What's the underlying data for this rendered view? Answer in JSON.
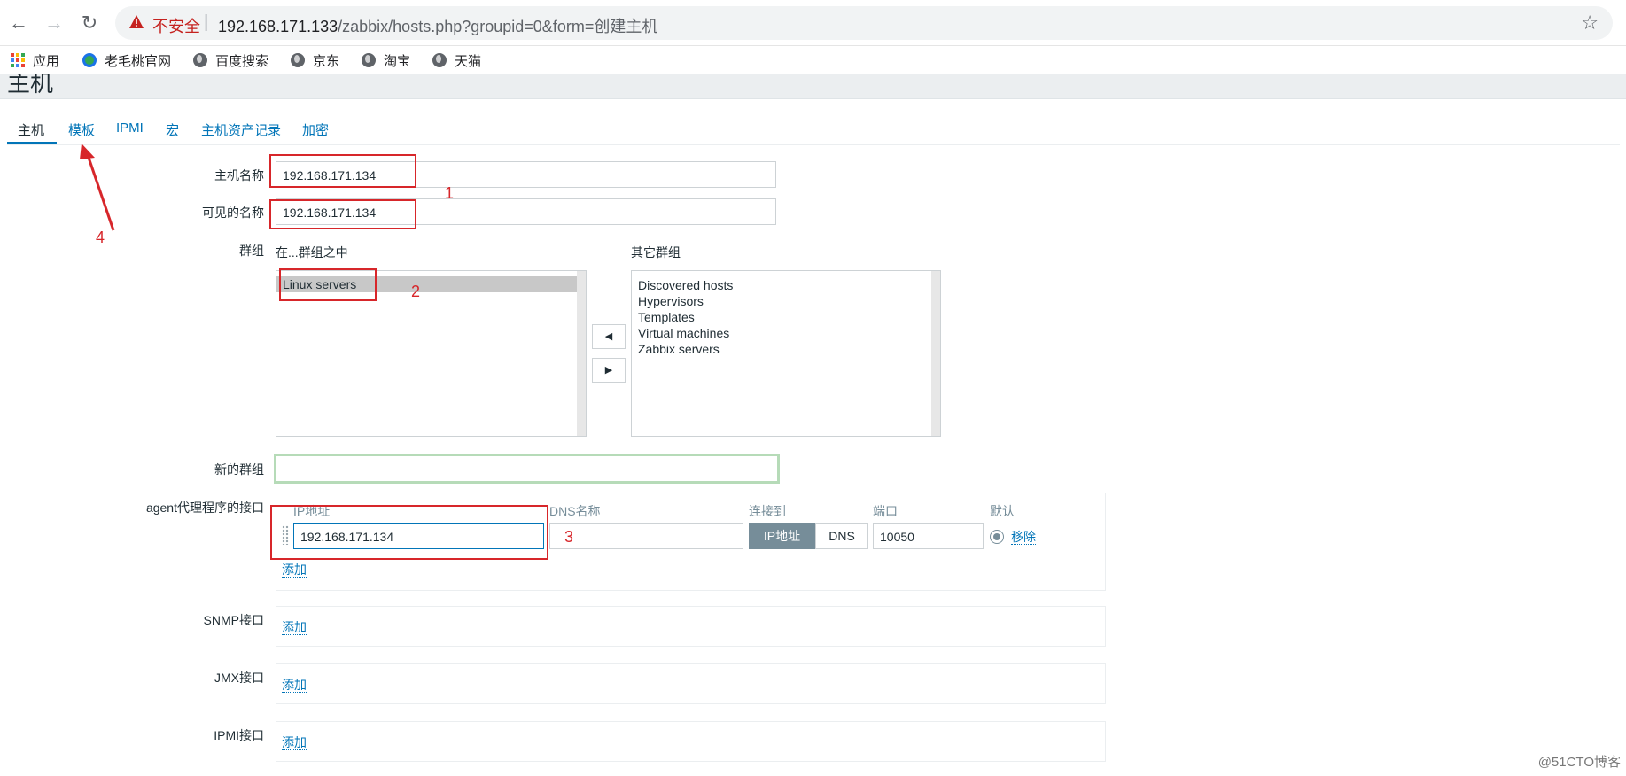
{
  "browser": {
    "insecure_label": "不安全",
    "url_host": "192.168.171.133",
    "url_rest": "/zabbix/hosts.php?groupid=0&form=创建主机",
    "bookmarks": [
      "应用",
      "老毛桃官网",
      "百度搜索",
      "京东",
      "淘宝",
      "天猫"
    ]
  },
  "page": {
    "title": "主机",
    "tabs": [
      "主机",
      "模板",
      "IPMI",
      "宏",
      "主机资产记录",
      "加密"
    ]
  },
  "form": {
    "hostname_label": "主机名称",
    "hostname_value": "192.168.171.134",
    "visible_name_label": "可见的名称",
    "visible_name_value": "192.168.171.134",
    "groups_label": "群组",
    "in_groups_label": "在...群组之中",
    "other_groups_label": "其它群组",
    "in_groups": [
      "Linux servers"
    ],
    "other_groups": [
      "Discovered hosts",
      "Hypervisors",
      "Templates",
      "Virtual machines",
      "Zabbix servers"
    ],
    "move_left": "◀",
    "move_right": "▶",
    "new_group_label": "新的群组",
    "new_group_value": "",
    "agent_label": "agent代理程序的接口",
    "agent_columns": [
      "IP地址",
      "DNS名称",
      "连接到",
      "端口",
      "默认"
    ],
    "agent_ip": "192.168.171.134",
    "agent_dns": "",
    "connect_ip": "IP地址",
    "connect_dns": "DNS",
    "agent_port": "10050",
    "remove_label": "移除",
    "add_label": "添加",
    "snmp_label": "SNMP接口",
    "jmx_label": "JMX接口",
    "ipmi_label": "IPMI接口"
  },
  "annotations": [
    "1",
    "2",
    "3",
    "4"
  ],
  "watermark": "@51CTO博客",
  "colors": {
    "link": "#0275b8",
    "annotation": "#d7262a",
    "active_segment": "#768d99"
  }
}
